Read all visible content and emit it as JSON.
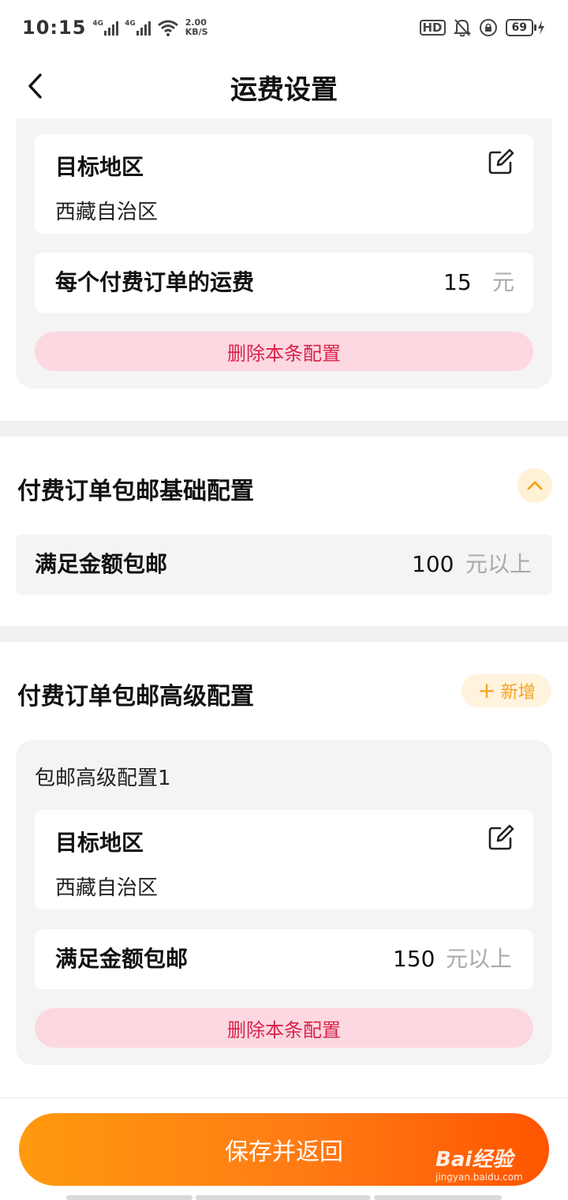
{
  "status_bar": {
    "time": "10:15",
    "signal_tag_1": "4G",
    "signal_tag_2": "4G",
    "net_speed_value": "2.00",
    "net_speed_unit": "KB/S",
    "hd_label": "HD",
    "battery_level": "69"
  },
  "header": {
    "title": "运费设置"
  },
  "paid_region_config": {
    "target_region_title": "目标地区",
    "target_region_value": "西藏自治区",
    "fee_label": "每个付费订单的运费",
    "fee_value": "15",
    "fee_unit": "元",
    "delete_label": "删除本条配置"
  },
  "basic_free_shipping": {
    "section_title": "付费订单包邮基础配置",
    "row_label": "满足金额包邮",
    "row_value": "100",
    "row_unit": "元以上"
  },
  "advanced_free_shipping": {
    "section_title": "付费订单包邮高级配置",
    "add_label": "新增",
    "add_symbol": "+",
    "item_label": "包邮高级配置1",
    "target_region_title": "目标地区",
    "target_region_value": "西藏自治区",
    "row_label": "满足金额包邮",
    "row_value": "150",
    "row_unit": "元以上",
    "delete_label": "删除本条配置"
  },
  "footer": {
    "save_label": "保存并返回"
  },
  "watermark": {
    "brand": "Bai经验",
    "url": "jingyan.baidu.com"
  },
  "colors": {
    "accent_orange": "#ff7a14",
    "delete_bg": "#fdd8e1",
    "delete_text": "#d8244a"
  }
}
